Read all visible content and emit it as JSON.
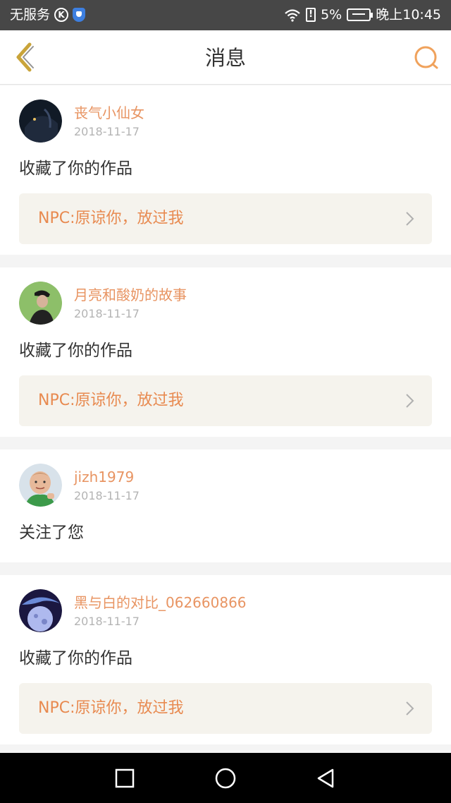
{
  "status_bar": {
    "carrier": "无服务",
    "k_badge": "K",
    "alert_badge": "!",
    "battery_percent": "5%",
    "time": "晚上10:45"
  },
  "header": {
    "title": "消息",
    "back_icon": "chevron-left-icon",
    "search_icon": "search-icon"
  },
  "colors": {
    "accent": "#e89462",
    "work_title": "#e88a50",
    "work_bg": "#f5f3ed",
    "back_arrow": "#c9a43a"
  },
  "messages": [
    {
      "username": "丧气小仙女",
      "date": "2018-11-17",
      "action": "收藏了你的作品",
      "work": "NPC:原谅你，放过我"
    },
    {
      "username": "月亮和酸奶的故事",
      "date": "2018-11-17",
      "action": "收藏了你的作品",
      "work": "NPC:原谅你，放过我"
    },
    {
      "username": "jizh1979",
      "date": "2018-11-17",
      "action": "关注了您"
    },
    {
      "username": "黑与白的对比_062660866",
      "date": "2018-11-17",
      "action": "收藏了你的作品",
      "work": "NPC:原谅你，放过我"
    }
  ],
  "nav_bar": {
    "buttons": [
      "recent-apps-icon",
      "home-icon",
      "back-icon"
    ]
  }
}
